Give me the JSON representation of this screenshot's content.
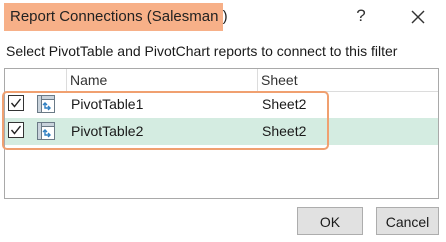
{
  "dialog": {
    "title": "Report Connections (Salesman )",
    "help_glyph": "?",
    "close_icon": "close-icon"
  },
  "instruction": "Select PivotTable and PivotChart reports to connect to this filter",
  "list": {
    "columns": [
      "",
      "Name",
      "Sheet"
    ],
    "rows": [
      {
        "checked": true,
        "icon": "pivottable-icon",
        "name": "PivotTable1",
        "sheet": "Sheet2",
        "selected": false
      },
      {
        "checked": true,
        "icon": "pivottable-icon",
        "name": "PivotTable2",
        "sheet": "Sheet2",
        "selected": true
      }
    ]
  },
  "buttons": {
    "ok_label": "OK",
    "cancel_label": "Cancel"
  },
  "colors": {
    "title_highlight": "#f7b088",
    "annotation_border": "#f0a070",
    "selected_row": "#d4ece1"
  }
}
